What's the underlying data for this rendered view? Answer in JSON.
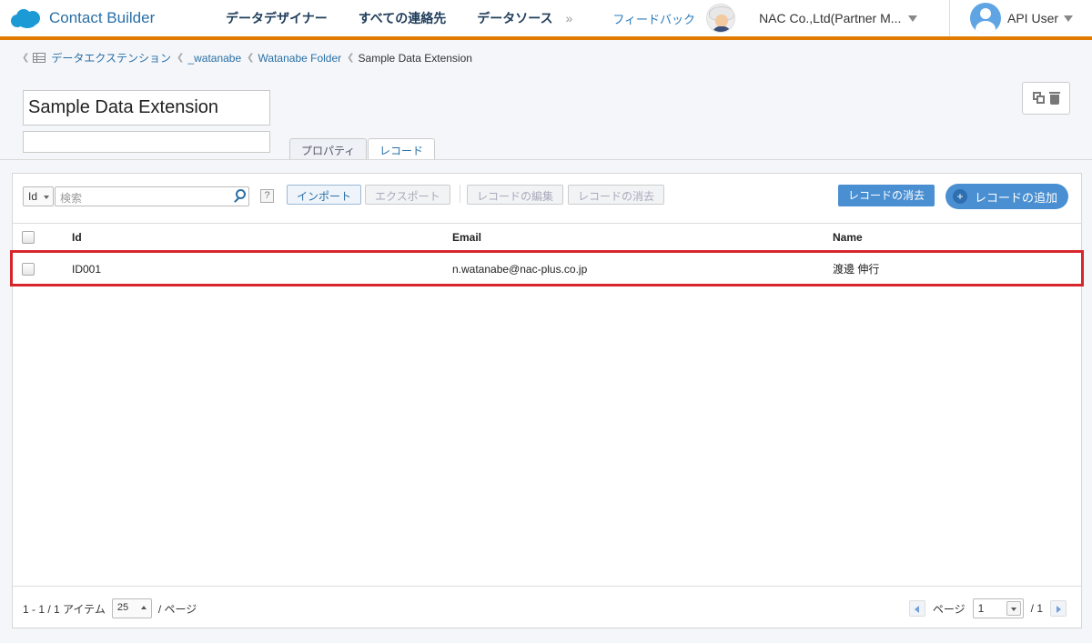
{
  "header": {
    "app_name": "Contact Builder",
    "nav": [
      "データデザイナー",
      "すべての連絡先",
      "データソース"
    ],
    "more": "»",
    "feedback": "フィードバック",
    "org": "NAC Co.,Ltd(Partner M...",
    "user": "API User"
  },
  "breadcrumb": {
    "root": "データエクステンション",
    "items": [
      "_watanabe",
      "Watanabe Folder"
    ],
    "current": "Sample Data Extension"
  },
  "extension": {
    "name": "Sample Data Extension",
    "description": ""
  },
  "tabs": [
    "プロパティ",
    "レコード"
  ],
  "toolbar": {
    "field": "Id",
    "search_placeholder": "検索",
    "help": "?",
    "import": "インポート",
    "export": "エクスポート",
    "edit": "レコードの編集",
    "remove": "レコードの消去",
    "delete_records": "レコードの消去",
    "add_record": "レコードの追加",
    "add_plus": "+"
  },
  "table": {
    "columns": [
      "Id",
      "Email",
      "Name"
    ],
    "rows": [
      {
        "id": "ID001",
        "email": "n.watanabe@nac-plus.co.jp",
        "name": "渡邊 伸行"
      }
    ]
  },
  "footer": {
    "range": "1 - 1 / 1 アイテム",
    "per_page": "25",
    "per_page_suffix": "/ ページ",
    "page_label": "ページ",
    "page": "1",
    "total_pages": "/ 1"
  },
  "colors": {
    "accent": "#e07b00",
    "primary_button": "#4a8fd1",
    "highlight": "#d6262c"
  }
}
